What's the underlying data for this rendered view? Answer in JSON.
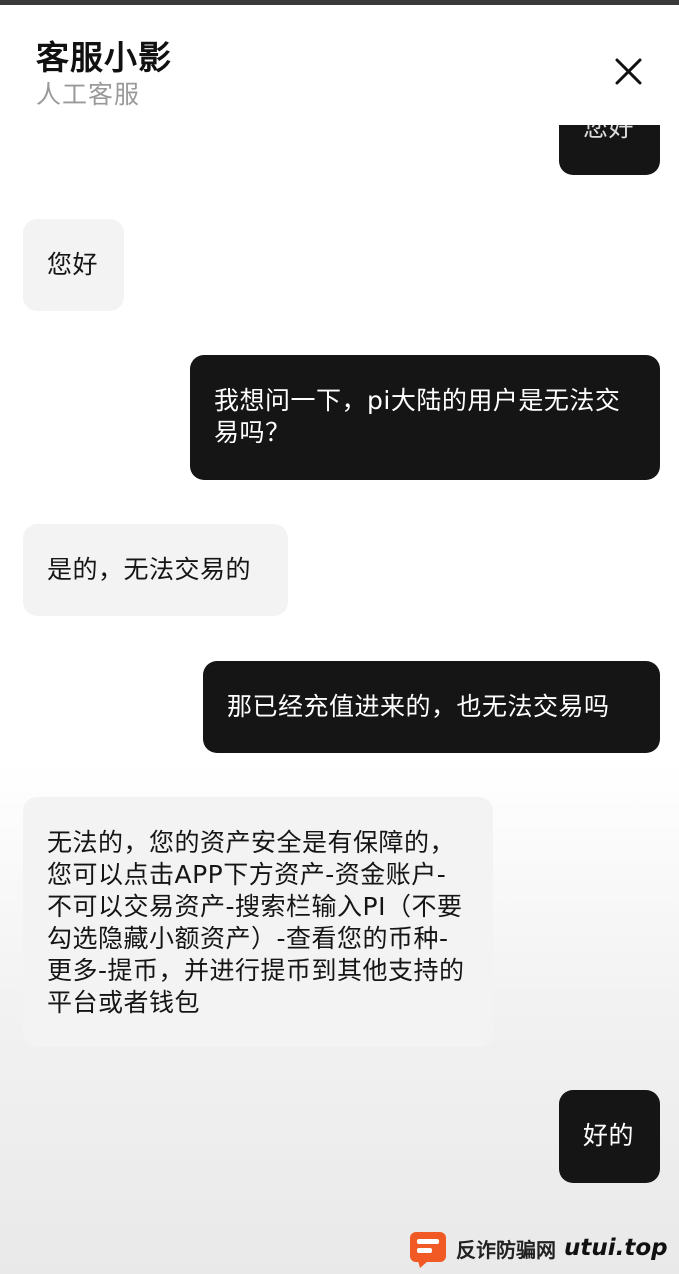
{
  "header": {
    "agent_name": "客服小影",
    "agent_role": "人工客服"
  },
  "messages": [
    {
      "from": "user",
      "text": "您好"
    },
    {
      "from": "agent",
      "text": "您好"
    },
    {
      "from": "user",
      "text": "我想问一下，pi大陆的用户是无法交易吗？"
    },
    {
      "from": "agent",
      "text": "是的，无法交易的"
    },
    {
      "from": "user",
      "text": "那已经充值进来的，也无法交易吗"
    },
    {
      "from": "agent",
      "text": "无法的，您的资产安全是有保障的，您可以点击APP下方资产-资金账户-不可以交易资产-搜索栏输入PI（不要勾选隐藏小额资产）-查看您的币种-更多-提币，并进行提币到其他支持的平台或者钱包"
    },
    {
      "from": "user",
      "text": "好的"
    }
  ],
  "watermark": {
    "text": "反诈防骗网",
    "site": "utui.top"
  },
  "colors": {
    "user_bubble": "#151515",
    "agent_bubble": "#f3f3f3",
    "watermark_logo": "#f15a24"
  }
}
